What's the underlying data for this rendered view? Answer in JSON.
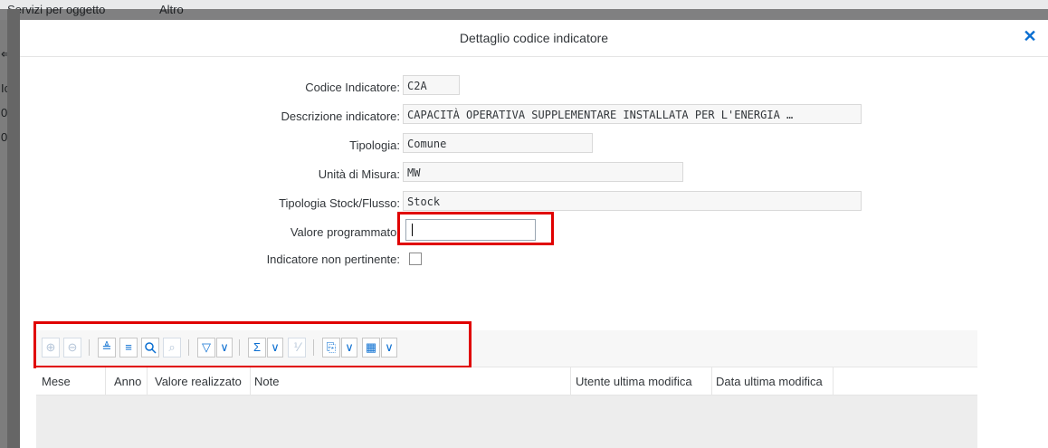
{
  "background": {
    "menu": [
      "Servizi per oggetto",
      "Altro"
    ],
    "left_glyphs": [
      "⇐",
      "Ic",
      "0",
      "0"
    ]
  },
  "dialog": {
    "title": "Dettaglio codice indicatore",
    "close_icon": "close-icon"
  },
  "form": {
    "codice_label": "Codice Indicatore:",
    "codice_value": "C2A",
    "descrizione_label": "Descrizione indicatore:",
    "descrizione_value": "CAPACITÀ OPERATIVA SUPPLEMENTARE INSTALLATA PER L'ENERGIA …",
    "tipologia_label": "Tipologia:",
    "tipologia_value": "Comune",
    "unita_label": "Unità di Misura:",
    "unita_value": "MW",
    "stock_label": "Tipologia Stock/Flusso:",
    "stock_value": "Stock",
    "valore_label": "Valore programmato:",
    "valore_value": "",
    "non_pertinente_label": "Indicatore non pertinente:"
  },
  "toolbar": {
    "buttons": [
      {
        "icon": "add-row-icon",
        "glyph": "⊕"
      },
      {
        "icon": "remove-row-icon",
        "glyph": "⊖"
      },
      {
        "icon": "sort-ascending-icon",
        "glyph": "≜"
      },
      {
        "icon": "sort-descending-icon",
        "glyph": "≡"
      },
      {
        "icon": "search-icon",
        "glyph": "🔍"
      },
      {
        "icon": "search-next-icon",
        "glyph": "⌕"
      },
      {
        "icon": "filter-icon",
        "glyph": "▽"
      },
      {
        "icon": "sum-icon",
        "glyph": "Σ"
      },
      {
        "icon": "subtotal-icon",
        "glyph": "⅟"
      },
      {
        "icon": "export-icon",
        "glyph": "⎘"
      },
      {
        "icon": "layout-icon",
        "glyph": "▦"
      }
    ],
    "dropdown_glyph": "∨"
  },
  "table": {
    "columns": [
      "Mese",
      "Anno",
      "Valore realizzato",
      "Note",
      "Utente ultima modifica",
      "Data ultima modifica"
    ]
  }
}
